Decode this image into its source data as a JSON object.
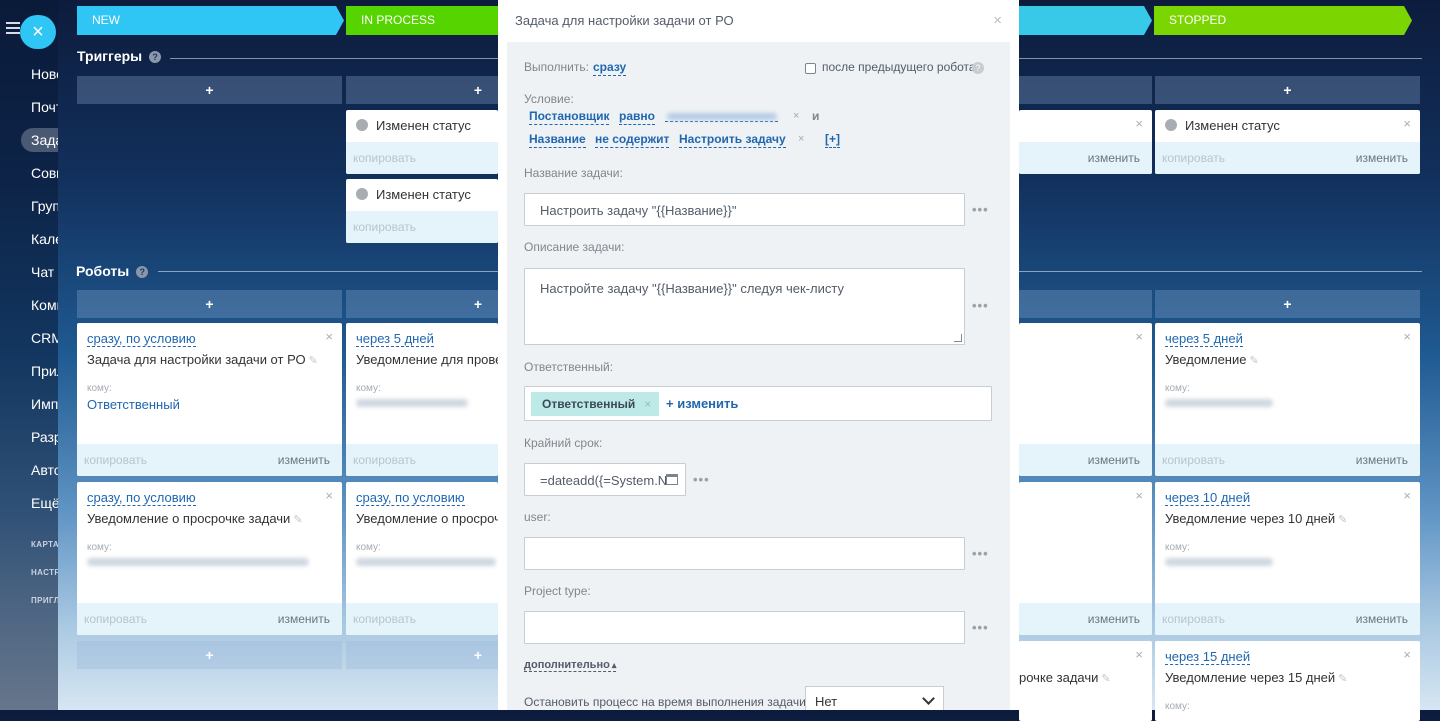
{
  "sidebar": {
    "close_label": "×",
    "items": [
      "Новости",
      "Почта",
      "Задачи",
      "Совместная работа",
      "Группы",
      "Календарь",
      "Чат и звонки",
      "Компания",
      "CRM",
      "Приложения",
      "Импорт",
      "Разработчикам",
      "Автоматизация",
      "Ещё"
    ],
    "small_items": [
      "КАРТА",
      "НАСТРОЙКИ",
      "ПРИГЛАСИТЬ"
    ]
  },
  "stages": [
    {
      "name": "NEW",
      "color": "#2fc6f6",
      "text_color": "#ffffff"
    },
    {
      "name": "IN PROCESS",
      "color": "#55d400",
      "text_color": "#ffffff"
    },
    {
      "name": "",
      "color": "#38c8e8",
      "text_color": "#ffffff"
    },
    {
      "name": "STOPPED",
      "color": "#7bd500",
      "text_color": "#ffffff"
    }
  ],
  "triggers_section": {
    "title": "Триггеры",
    "help": "?"
  },
  "robots_section": {
    "title": "Роботы",
    "help": "?"
  },
  "add_label": "+",
  "triggers": [
    {
      "name": "Изменен статус",
      "copy": "копировать",
      "edit": "изменить",
      "close": "×"
    },
    {
      "name": "Изменен статус",
      "copy": "копировать",
      "edit": "изменить",
      "close": "×"
    },
    {
      "name": "",
      "copy": "",
      "edit": "изменить",
      "close": "×"
    },
    {
      "name": "Изменен статус",
      "copy": "копировать",
      "edit": "изменить",
      "close": "×"
    }
  ],
  "robots": [
    {
      "delay": "сразу, по условию",
      "title": "Задача для настройки задачи от РО",
      "to_label": "кому:",
      "to_value": "Ответственный",
      "copy": "копировать",
      "edit": "изменить"
    },
    {
      "delay": "через 5 дней",
      "title": "Уведомление для прове",
      "to_label": "кому:",
      "to_value": "",
      "copy": "копировать",
      "edit": "изменить"
    },
    {
      "delay": "через 5 дней",
      "title": "Уведомление",
      "to_label": "кому:",
      "to_value": "",
      "copy": "копировать",
      "edit": "изменить"
    },
    {
      "delay": "сразу, по условию",
      "title": "Уведомление о просрочке задачи",
      "to_label": "кому:",
      "to_value": "",
      "copy": "копировать",
      "edit": "изменить"
    },
    {
      "delay": "сразу, по условию",
      "title": "Уведомление о просроч",
      "to_label": "кому:",
      "to_value": "",
      "copy": "копировать",
      "edit": "изменить"
    },
    {
      "delay": "через 10 дней",
      "title": "Уведомление через 10 дней",
      "to_label": "кому:",
      "to_value": "",
      "copy": "копировать",
      "edit": "изменить"
    },
    {
      "delay": "",
      "title": "рочке задачи",
      "to_label": "",
      "to_value": "",
      "copy": "",
      "edit": ""
    },
    {
      "delay": "через 15 дней",
      "title": "Уведомление через 15 дней",
      "to_label": "кому:",
      "to_value": "",
      "copy": "",
      "edit": ""
    }
  ],
  "partial_edit": "изменить",
  "modal": {
    "title": "Задача для настройки задачи от РО",
    "close": "×",
    "execute_label": "Выполнить:",
    "execute_value": "сразу",
    "after_prev_label": "после предыдущего робота",
    "help": "?",
    "condition_label": "Условие:",
    "condition1": {
      "field": "Постановщик",
      "op": "равно",
      "value": "",
      "remove": "×",
      "join": "и"
    },
    "condition2": {
      "field": "Название",
      "op": "не содержит",
      "value": "Настроить задачу",
      "remove": "×",
      "add": "[+]"
    },
    "task_name_label": "Название задачи:",
    "task_name_value": "Настроить задачу \"{{Название}}\"",
    "task_desc_label": "Описание задачи:",
    "task_desc_value": "Настройте задачу \"{{Название}}\" следуя чек-листу",
    "responsible_label": "Ответственный:",
    "responsible_tag": "Ответственный",
    "responsible_tag_remove": "×",
    "responsible_change": "+ изменить",
    "deadline_label": "Крайний срок:",
    "deadline_value": "=dateadd({=System.N",
    "user_label": "user:",
    "user_value": "",
    "project_type_label": "Project type:",
    "project_type_value": "",
    "more_label": "дополнительно",
    "more_arrow": "▴",
    "stop_process_label": "Остановить процесс на время выполнения задачи:",
    "stop_process_value": "Нет",
    "dots": "•••"
  }
}
